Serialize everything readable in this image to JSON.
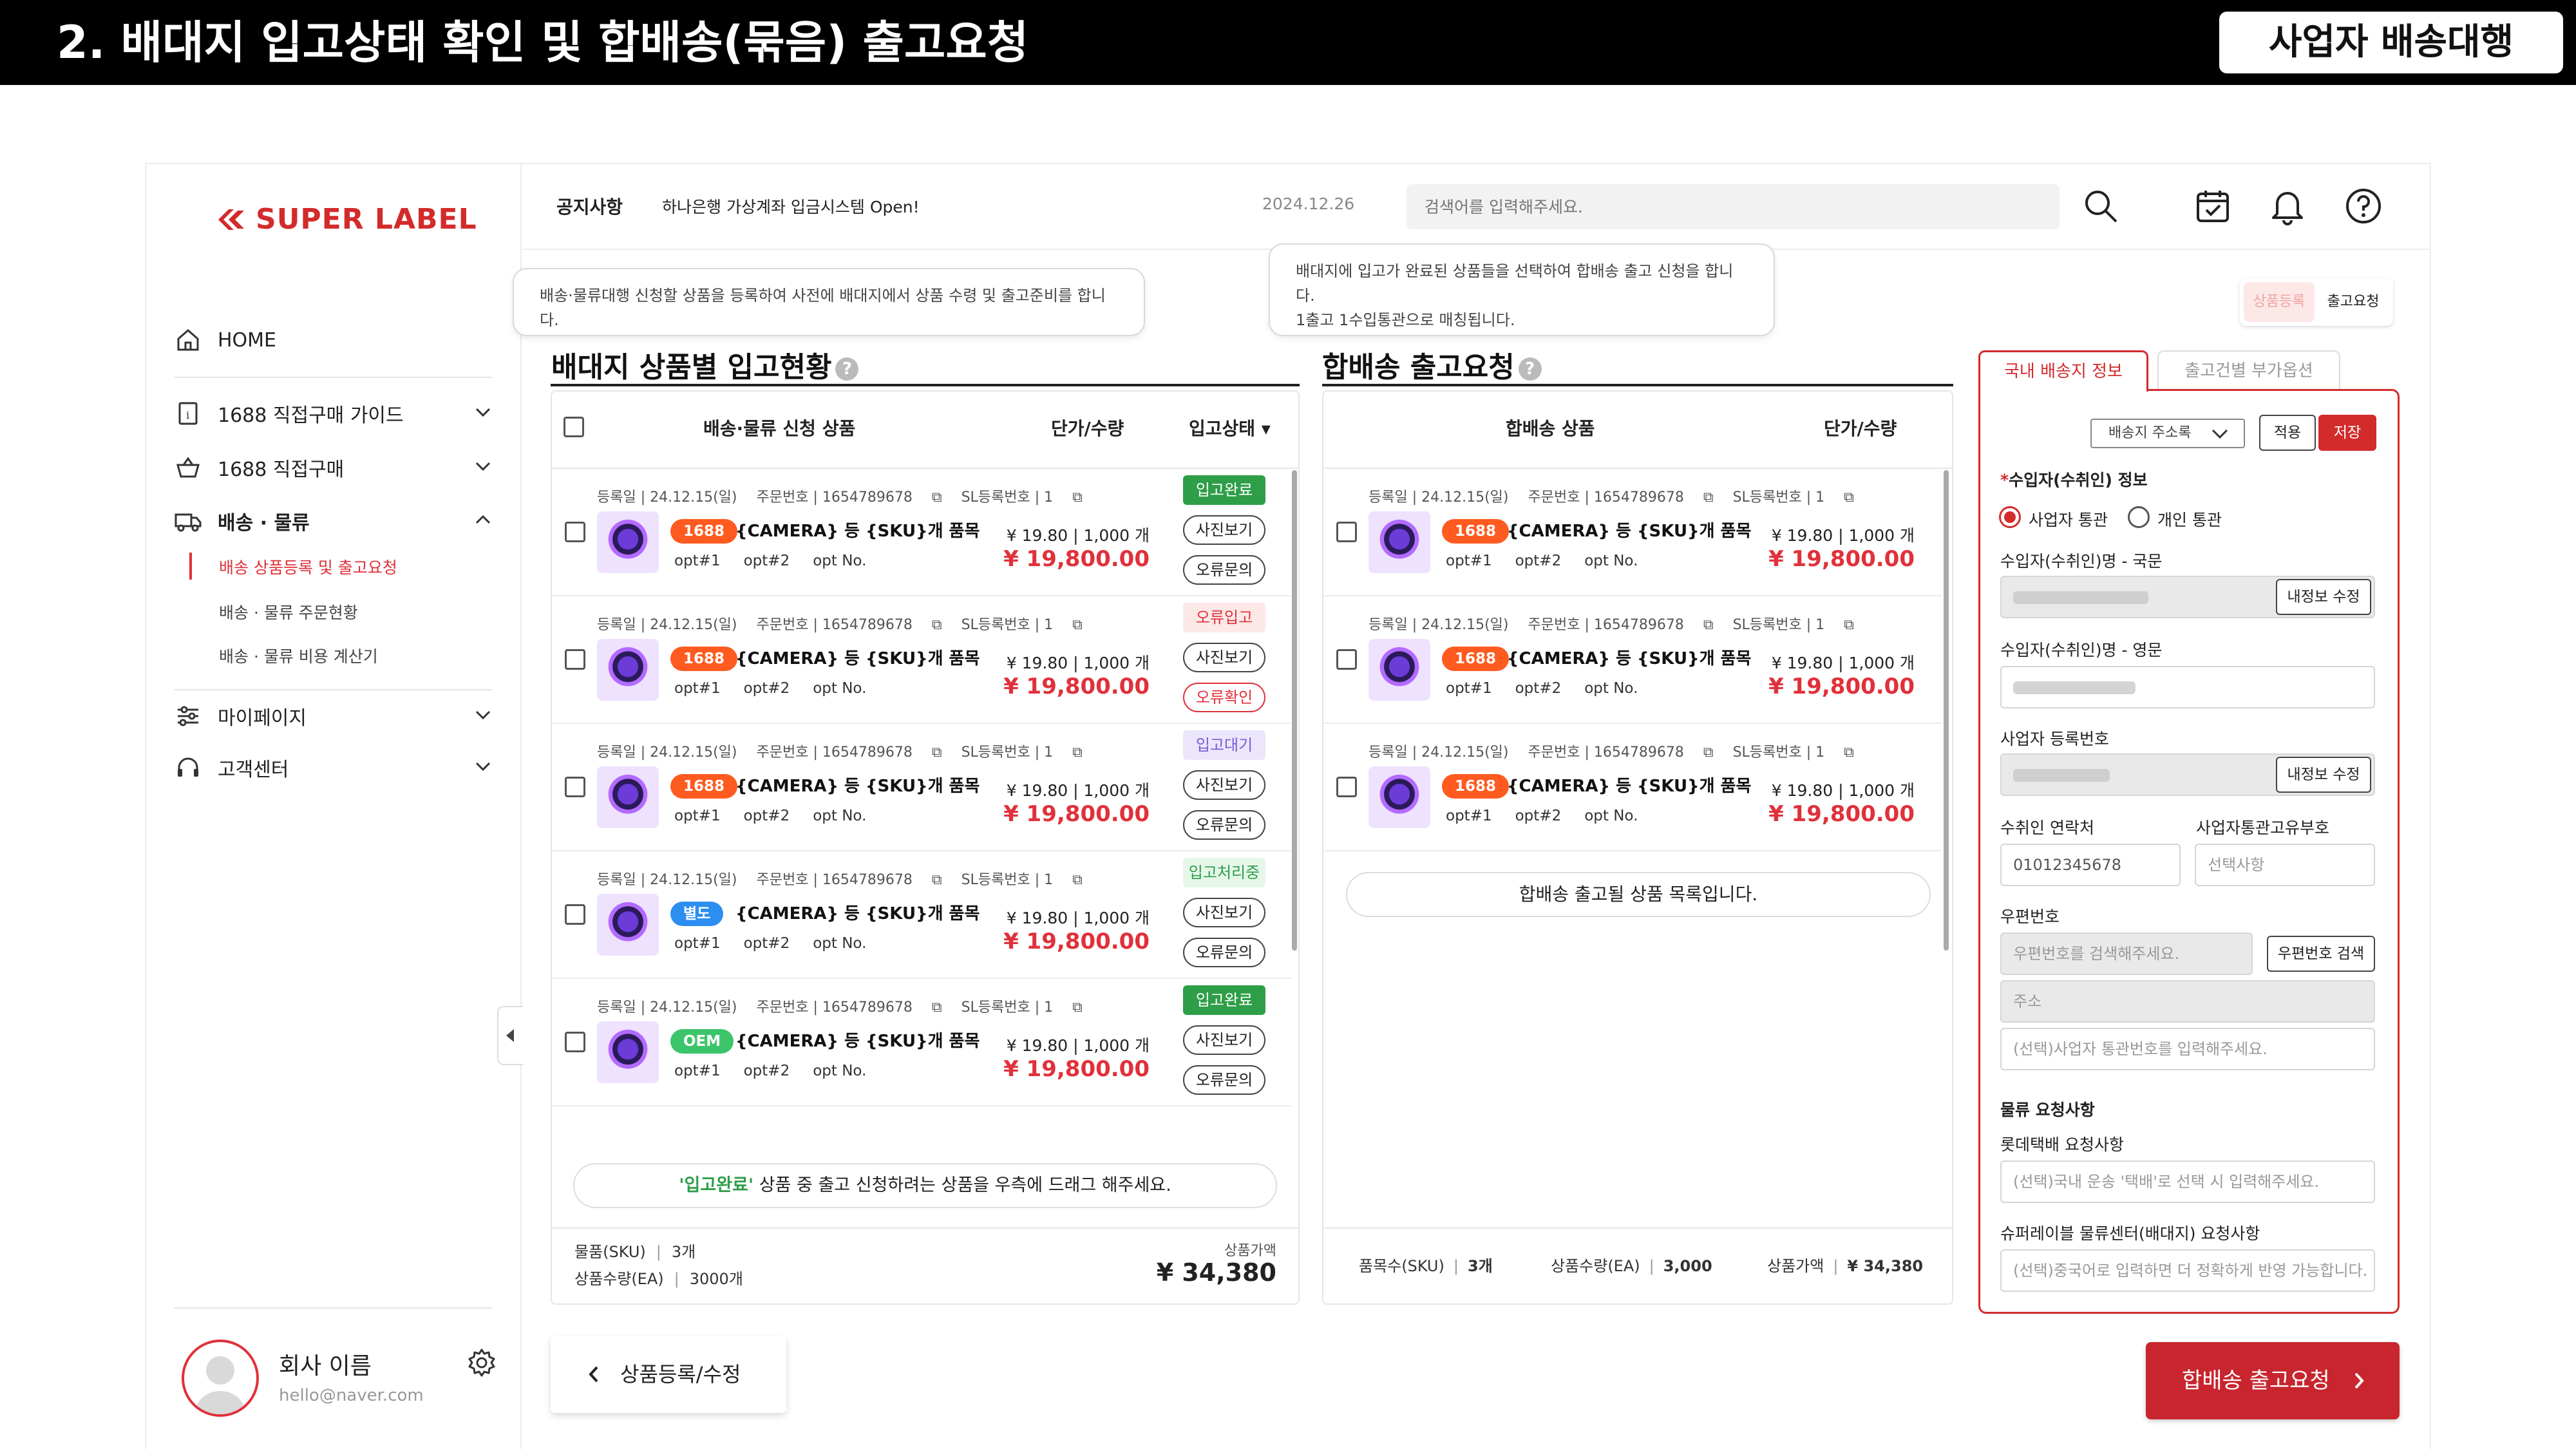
{
  "banner": {
    "title": "2. 배대지 입고상태 확인 및 합배송(묶음) 출고요청",
    "badge": "사업자 배송대행"
  },
  "brand": {
    "logo_text": "SUPER LABEL",
    "accent": "#d32b2b"
  },
  "sidebar": {
    "home": "HOME",
    "guide": "1688 직접구매 가이드",
    "purchase": "1688 직접구매",
    "shipping": "배송 · 물류",
    "sub_items": [
      "배송 상품등록 및 출고요청",
      "배송 · 물류 주문현황",
      "배송 · 물류 비용 계산기"
    ],
    "mypage": "마이페이지",
    "support": "고객센터",
    "profile_name": "회사 이름",
    "profile_email": "hello@naver.com"
  },
  "header": {
    "notice_label": "공지사항",
    "notice_text": "하나은행 가상계좌 입금시스템 Open!",
    "notice_date": "2024.12.26",
    "search_placeholder": "검색어를 입력해주세요."
  },
  "tooltips": {
    "left": "배송·물류대행 신청할 상품을 등록하여 사전에 배대지에서 상품 수령 및 출고준비를 합니다.",
    "right_line1": "배대지에 입고가 완료된 상품들을 선택하여 합배송 출고 신청을 합니다.",
    "right_line2": "1출고 1수입통관으로 매칭됩니다."
  },
  "toggle": {
    "register": "상품등록",
    "release": "출고요청"
  },
  "left_panel": {
    "title": "배대지 상품별 입고현황",
    "col_product": "배송·물류 신청 상품",
    "col_price": "단가/수량",
    "col_status": "입고상태 ▾",
    "drag_hint_highlight": "'입고완료'",
    "drag_hint_rest": " 상품 중 출고 신청하려는 상품을 우측에 드래그 해주세요.",
    "summary_sku_label": "물품(SKU)",
    "summary_sku": "3개",
    "summary_ea_label": "상품수량(EA)",
    "summary_ea": "3000개",
    "summary_price_label": "상품가액",
    "summary_price": "¥ 34,380",
    "back_button": "상품등록/수정"
  },
  "rows": [
    {
      "date": "등록일 | 24.12.15(일)",
      "order": "주문번호 | 1654789678",
      "sl": "SL등록번호 | 1",
      "tag": "1688",
      "tag_color": "#ff5a1f",
      "name": "{CAMERA} 등 {SKU}개 품목",
      "opt1": "opt#1",
      "opt2": "opt#2",
      "opt3": "opt No.",
      "unit": "¥ 19.80 | 1,000 개",
      "price": "¥ 19,800.00",
      "status": "입고완료",
      "btn1": "사진보기",
      "btn2": "오류문의"
    },
    {
      "date": "등록일 | 24.12.15(일)",
      "order": "주문번호 | 1654789678",
      "sl": "SL등록번호 | 1",
      "tag": "1688",
      "tag_color": "#ff5a1f",
      "name": "{CAMERA} 등 {SKU}개 품목",
      "opt1": "opt#1",
      "opt2": "opt#2",
      "opt3": "opt No.",
      "unit": "¥ 19.80 | 1,000 개",
      "price": "¥ 19,800.00",
      "status": "오류입고",
      "btn1": "사진보기",
      "btn2": "오류확인"
    },
    {
      "date": "등록일 | 24.12.15(일)",
      "order": "주문번호 | 1654789678",
      "sl": "SL등록번호 | 1",
      "tag": "1688",
      "tag_color": "#ff5a1f",
      "name": "{CAMERA} 등 {SKU}개 품목",
      "opt1": "opt#1",
      "opt2": "opt#2",
      "opt3": "opt No.",
      "unit": "¥ 19.80 | 1,000 개",
      "price": "¥ 19,800.00",
      "status": "입고대기",
      "btn1": "사진보기",
      "btn2": "오류문의"
    },
    {
      "date": "등록일 | 24.12.15(일)",
      "order": "주문번호 | 1654789678",
      "sl": "SL등록번호 | 1",
      "tag": "별도",
      "tag_color": "#2b8ef0",
      "name": "{CAMERA} 등 {SKU}개 품목",
      "opt1": "opt#1",
      "opt2": "opt#2",
      "opt3": "opt No.",
      "unit": "¥ 19.80 | 1,000 개",
      "price": "¥ 19,800.00",
      "status": "입고처리중",
      "btn1": "사진보기",
      "btn2": "오류문의"
    },
    {
      "date": "등록일 | 24.12.15(일)",
      "order": "주문번호 | 1654789678",
      "sl": "SL등록번호 | 1",
      "tag": "OEM",
      "tag_color": "#3cc46a",
      "name": "{CAMERA} 등 {SKU}개 품목",
      "opt1": "opt#1",
      "opt2": "opt#2",
      "opt3": "opt No.",
      "unit": "¥ 19.80 | 1,000 개",
      "price": "¥ 19,800.00",
      "status": "입고완료",
      "btn1": "사진보기",
      "btn2": "오류문의"
    }
  ],
  "mid_panel": {
    "title": "합배송 출고요청",
    "col_product": "합배송 상품",
    "col_price": "단가/수량",
    "empty_hint": "합배송 출고될 상품 목록입니다.",
    "sum_sku_label": "품목수(SKU)",
    "sum_sku": "3개",
    "sum_ea_label": "상품수량(EA)",
    "sum_ea": "3,000",
    "sum_price_label": "상품가액",
    "sum_price": "¥ 34,380"
  },
  "mid_rows": [
    {
      "date": "등록일 | 24.12.15(일)",
      "order": "주문번호 | 1654789678",
      "sl": "SL등록번호 | 1",
      "tag": "1688",
      "name": "{CAMERA} 등 {SKU}개 품목",
      "opt1": "opt#1",
      "opt2": "opt#2",
      "opt3": "opt No.",
      "unit": "¥ 19.80 | 1,000 개",
      "price": "¥ 19,800.00"
    },
    {
      "date": "등록일 | 24.12.15(일)",
      "order": "주문번호 | 1654789678",
      "sl": "SL등록번호 | 1",
      "tag": "1688",
      "name": "{CAMERA} 등 {SKU}개 품목",
      "opt1": "opt#1",
      "opt2": "opt#2",
      "opt3": "opt No.",
      "unit": "¥ 19.80 | 1,000 개",
      "price": "¥ 19,800.00"
    },
    {
      "date": "등록일 | 24.12.15(일)",
      "order": "주문번호 | 1654789678",
      "sl": "SL등록번호 | 1",
      "tag": "1688",
      "name": "{CAMERA} 등 {SKU}개 품목",
      "opt1": "opt#1",
      "opt2": "opt#2",
      "opt3": "opt No.",
      "unit": "¥ 19.80 | 1,000 개",
      "price": "¥ 19,800.00"
    }
  ],
  "form": {
    "tab_active": "국내 배송지 정보",
    "tab_inactive": "출고건별 부가옵션",
    "address_book": "배송지 주소록",
    "apply": "적용",
    "save": "저장",
    "importer_title": "수입자(수취인) 정보",
    "radio_business": "사업자 통관",
    "radio_personal": "개인 통관",
    "name_kr_label": "수입자(수취인)명 - 국문",
    "name_en_label": "수입자(수취인)명 - 영문",
    "biz_no_label": "사업자 등록번호",
    "edit_info": "내정보 수정",
    "contact_label": "수취인 연락처",
    "contact_value": "01012345678",
    "customs_code_label": "사업자통관고유부호",
    "customs_code_placeholder": "선택사항",
    "zip_label": "우편번호",
    "zip_placeholder": "우편번호를 검색해주세요.",
    "zip_search": "우편번호 검색",
    "address_placeholder": "주소",
    "address_detail_placeholder": "(선택)사업자 통관번호를 입력해주세요.",
    "logistics_title": "물류 요청사항",
    "lotte_label": "롯데택배 요청사항",
    "lotte_placeholder": "(선택)국내 운송 '택배'로 선택 시 입력해주세요.",
    "center_label": "슈퍼레이블 물류센터(배대지) 요청사항",
    "center_placeholder": "(선택)중국어로 입력하면 더 정확하게 반영 가능합니다."
  },
  "submit": {
    "label": "합배송 출고요청"
  }
}
